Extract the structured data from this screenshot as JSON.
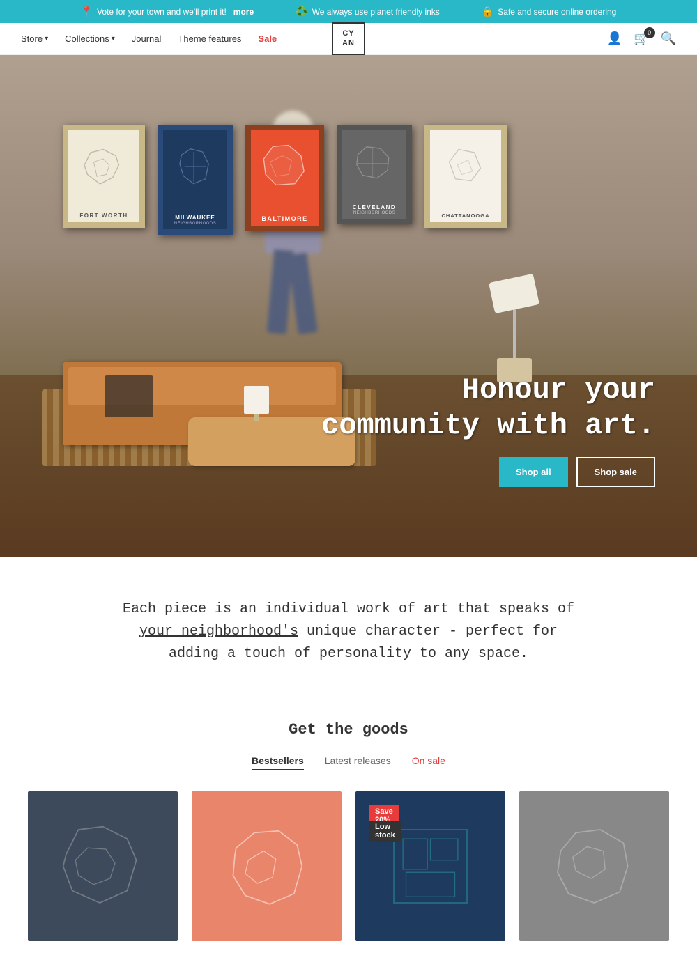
{
  "announcement": {
    "items": [
      {
        "icon": "📍",
        "text": "Vote for your town and we'll print it!",
        "link": "more"
      },
      {
        "icon": "♻️",
        "text": "We always use planet friendly inks"
      },
      {
        "icon": "🔒",
        "text": "Safe and secure online ordering"
      }
    ]
  },
  "nav": {
    "items": [
      {
        "label": "Store",
        "has_dropdown": true
      },
      {
        "label": "Collections",
        "has_dropdown": true
      },
      {
        "label": "Journal",
        "has_dropdown": false
      },
      {
        "label": "Theme features",
        "has_dropdown": false
      },
      {
        "label": "Sale",
        "is_sale": true
      }
    ],
    "logo": {
      "line1": "CY",
      "line2": "AN"
    },
    "cart_count": "0"
  },
  "hero": {
    "headline": "Honour your\ncommunity with art.",
    "btn_shop_all": "Shop all",
    "btn_shop_sale": "Shop sale",
    "posters": [
      {
        "city": "FORT WORTH",
        "style": "light"
      },
      {
        "city": "MILWAUKEE\nNEIGHBORHOODS",
        "style": "dark-blue"
      },
      {
        "city": "BALTIMORE",
        "style": "red"
      },
      {
        "city": "CLEVELAND\nNEIGHBORHOODS",
        "style": "dark-gray"
      },
      {
        "city": "CHATTANOOGA",
        "style": "light"
      }
    ]
  },
  "tagline": {
    "text_before": "Each piece is an individual work of art that speaks of ",
    "link_text": "your neighborhood's",
    "text_after": " unique character - perfect for adding a touch of personality to any space."
  },
  "products": {
    "section_title": "Get the goods",
    "tabs": [
      {
        "label": "Bestsellers",
        "active": true
      },
      {
        "label": "Latest releases",
        "active": false
      },
      {
        "label": "On sale",
        "active": false,
        "is_sale": true
      }
    ],
    "items": [
      {
        "bg": "dark-gray",
        "badge": null,
        "low_stock": false
      },
      {
        "bg": "salmon",
        "badge": null,
        "low_stock": false
      },
      {
        "bg": "dark-blue",
        "badge": "Save 20%",
        "low_stock": true
      },
      {
        "bg": "medium-gray",
        "badge": null,
        "low_stock": false
      }
    ]
  }
}
